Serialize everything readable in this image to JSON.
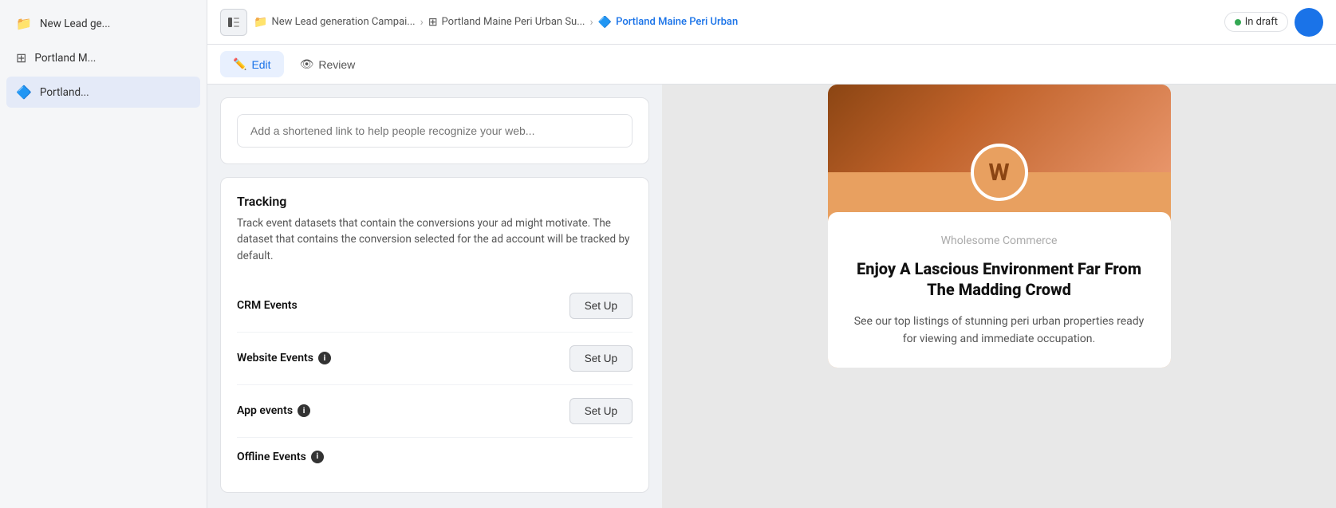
{
  "sidebar": {
    "items": [
      {
        "id": "campaign",
        "label": "New Lead ge...",
        "icon": "📁",
        "active": false
      },
      {
        "id": "adset",
        "label": "Portland M...",
        "icon": "⊞",
        "active": false
      },
      {
        "id": "ad",
        "label": "Portland...",
        "icon": "🔷",
        "active": true
      }
    ]
  },
  "topbar": {
    "toggle_icon": "▣",
    "breadcrumbs": [
      {
        "label": "New Lead generation Campai...",
        "icon": "📁",
        "active": false
      },
      {
        "label": "Portland Maine Peri Urban Su...",
        "icon": "⊞",
        "active": false
      },
      {
        "label": "Portland Maine Peri Urban",
        "icon": "🔷",
        "active": true
      }
    ],
    "status": "In draft",
    "status_color": "#34a853"
  },
  "tabs": [
    {
      "id": "edit",
      "label": "Edit",
      "active": true,
      "icon": "✏️"
    },
    {
      "id": "review",
      "label": "Review",
      "active": false,
      "icon": "👁"
    }
  ],
  "form": {
    "shortened_link_placeholder": "Add a shortened link to help people recognize your web...",
    "tracking": {
      "title": "Tracking",
      "description": "Track event datasets that contain the conversions your ad might motivate. The dataset that contains the conversion selected for the ad account will be tracked by default.",
      "rows": [
        {
          "label": "CRM Events",
          "has_info": false,
          "button": "Set Up"
        },
        {
          "label": "Website Events",
          "has_info": true,
          "button": "Set Up"
        },
        {
          "label": "App events",
          "has_info": true,
          "button": "Set Up"
        },
        {
          "label": "Offline Events",
          "has_info": true,
          "button": ""
        }
      ]
    }
  },
  "preview": {
    "avatar_letter": "W",
    "company": "Wholesome Commerce",
    "headline": "Enjoy A Lascious Environment Far From The Madding Crowd",
    "description": "See our top listings of stunning peri urban properties ready for viewing and immediate occupation."
  }
}
